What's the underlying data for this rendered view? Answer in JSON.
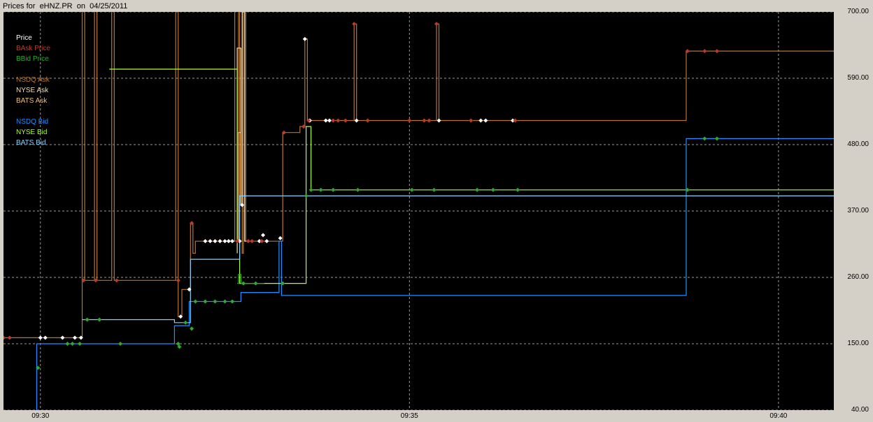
{
  "window": {
    "title": "Prices for  eHNZ.PR  on  04/25/2011"
  },
  "chart_data": {
    "type": "line",
    "title": "Prices for  eHNZ.PR  on  04/25/2011",
    "background": "#000000",
    "grid": true,
    "ylim": [
      40,
      700
    ],
    "yticks": [
      "700.00",
      "590.00",
      "480.00",
      "370.00",
      "260.00",
      "150.00",
      "40.00"
    ],
    "xlim": [
      "09:29:30",
      "09:40:45"
    ],
    "xticks": [
      "09:30",
      "09:35",
      "09:40"
    ],
    "legend_placement": "top-left",
    "legend": [
      {
        "label": "Price",
        "color": "#ffffff"
      },
      {
        "label": "BAsk Price",
        "color": "#c0392b"
      },
      {
        "label": "BBid Price",
        "color": "#2eaa2e"
      },
      {
        "label": "",
        "color": ""
      },
      {
        "label": "NSDQ Ask",
        "color": "#b87333"
      },
      {
        "label": "NYSE Ask",
        "color": "#f5deb3"
      },
      {
        "label": "BATS Ask",
        "color": "#f0c080"
      },
      {
        "label": "",
        "color": ""
      },
      {
        "label": "NSDQ Bid",
        "color": "#1e90ff"
      },
      {
        "label": "NYSE Bid",
        "color": "#adff2f"
      },
      {
        "label": "BATS Bid",
        "color": "#87cefa"
      }
    ],
    "series": [
      {
        "name": "NSDQ Ask",
        "color": "#b87333",
        "points": [
          [
            "09:29:30",
            160
          ],
          [
            "09:30:30",
            160
          ],
          [
            "09:30:34",
            160
          ],
          [
            "09:30:34",
            730
          ],
          [
            "09:30:36",
            730
          ],
          [
            "09:30:36",
            255
          ],
          [
            "09:30:44",
            255
          ],
          [
            "09:30:44",
            730
          ],
          [
            "09:30:46",
            730
          ],
          [
            "09:30:46",
            255
          ],
          [
            "09:30:58",
            255
          ],
          [
            "09:30:58",
            730
          ],
          [
            "09:31:00",
            730
          ],
          [
            "09:31:00",
            255
          ],
          [
            "09:31:50",
            255
          ],
          [
            "09:31:50",
            730
          ],
          [
            "09:31:52",
            730
          ],
          [
            "09:31:52",
            195
          ],
          [
            "09:31:55",
            195
          ],
          [
            "09:31:55",
            240
          ],
          [
            "09:32:02",
            240
          ],
          [
            "09:32:02",
            350
          ],
          [
            "09:32:04",
            350
          ],
          [
            "09:32:04",
            300
          ],
          [
            "09:32:06",
            300
          ],
          [
            "09:32:06",
            320
          ],
          [
            "09:32:38",
            320
          ],
          [
            "09:32:38",
            730
          ],
          [
            "09:32:41",
            730
          ],
          [
            "09:32:41",
            320
          ],
          [
            "09:32:42",
            320
          ],
          [
            "09:32:42",
            700
          ],
          [
            "09:32:44",
            700
          ],
          [
            "09:32:44",
            300
          ],
          [
            "09:32:45",
            300
          ],
          [
            "09:32:45",
            730
          ],
          [
            "09:32:47",
            730
          ],
          [
            "09:32:47",
            320
          ],
          [
            "09:33:17",
            320
          ],
          [
            "09:33:17",
            500
          ],
          [
            "09:33:31",
            500
          ],
          [
            "09:33:31",
            510
          ],
          [
            "09:33:35",
            510
          ],
          [
            "09:33:35",
            655
          ],
          [
            "09:33:37",
            655
          ],
          [
            "09:33:37",
            520
          ],
          [
            "09:34:15",
            520
          ],
          [
            "09:34:15",
            680
          ],
          [
            "09:34:17",
            680
          ],
          [
            "09:34:17",
            520
          ],
          [
            "09:35:22",
            520
          ],
          [
            "09:35:22",
            680
          ],
          [
            "09:35:24",
            680
          ],
          [
            "09:35:24",
            520
          ],
          [
            "09:38:45",
            520
          ],
          [
            "09:38:45",
            635
          ],
          [
            "09:40:45",
            635
          ]
        ]
      },
      {
        "name": "NYSE Ask",
        "color": "#f5deb3",
        "points": [
          [
            "09:32:40",
            300
          ],
          [
            "09:32:40",
            640
          ],
          [
            "09:32:43",
            640
          ],
          [
            "09:32:43",
            380
          ],
          [
            "09:32:44",
            380
          ],
          [
            "09:32:44",
            700
          ],
          [
            "09:32:46",
            700
          ],
          [
            "09:32:46",
            320
          ],
          [
            "09:32:48",
            320
          ]
        ]
      },
      {
        "name": "BATS Ask",
        "color": "#f0c080",
        "points": [
          [
            "09:32:41",
            320
          ],
          [
            "09:32:41",
            500
          ],
          [
            "09:32:43",
            500
          ],
          [
            "09:32:43",
            380
          ]
        ]
      },
      {
        "name": "NSDQ Bid",
        "color": "#1e90ff",
        "points": [
          [
            "09:29:57",
            40
          ],
          [
            "09:29:57",
            150
          ],
          [
            "09:31:49",
            150
          ],
          [
            "09:31:49",
            180
          ],
          [
            "09:32:01",
            180
          ],
          [
            "09:32:01",
            220
          ],
          [
            "09:32:43",
            220
          ],
          [
            "09:32:43",
            235
          ],
          [
            "09:33:14",
            235
          ],
          [
            "09:33:14",
            320
          ],
          [
            "09:33:16",
            320
          ],
          [
            "09:33:16",
            230
          ],
          [
            "09:38:45",
            230
          ],
          [
            "09:38:45",
            490
          ],
          [
            "09:40:45",
            490
          ]
        ]
      },
      {
        "name": "NYSE Bid",
        "color": "#adff2f",
        "points": [
          [
            "09:30:56",
            605
          ],
          [
            "09:32:40",
            605
          ],
          [
            "09:32:40",
            320
          ],
          [
            "09:32:42",
            320
          ],
          [
            "09:32:42",
            250
          ],
          [
            "09:33:36",
            250
          ],
          [
            "09:33:36",
            510
          ],
          [
            "09:33:40",
            510
          ],
          [
            "09:33:40",
            405
          ],
          [
            "09:40:45",
            405
          ]
        ]
      },
      {
        "name": "BATS Bid",
        "color": "#87cefa",
        "points": [
          [
            "09:30:34",
            190
          ],
          [
            "09:31:49",
            190
          ],
          [
            "09:31:49",
            185
          ],
          [
            "09:32:02",
            185
          ],
          [
            "09:32:02",
            290
          ],
          [
            "09:32:42",
            290
          ],
          [
            "09:32:42",
            395
          ],
          [
            "09:40:45",
            395
          ]
        ]
      },
      {
        "name": "BBid Price",
        "color": "#2eaa2e",
        "points": [
          [
            "09:32:40",
            250
          ],
          [
            "09:32:41",
            250
          ],
          [
            "09:32:41",
            265
          ],
          [
            "09:32:43",
            265
          ],
          [
            "09:32:43",
            250
          ],
          [
            "09:33:02",
            250
          ]
        ]
      }
    ],
    "markers": [
      {
        "series": "Price",
        "color": "#ffffff",
        "points": [
          [
            "09:30:00",
            160
          ],
          [
            "09:30:04",
            160
          ],
          [
            "09:30:18",
            160
          ],
          [
            "09:30:28",
            160
          ],
          [
            "09:30:33",
            160
          ],
          [
            "09:31:54",
            195
          ],
          [
            "09:32:01",
            240
          ],
          [
            "09:32:14",
            320
          ],
          [
            "09:32:18",
            320
          ],
          [
            "09:32:22",
            320
          ],
          [
            "09:32:26",
            320
          ],
          [
            "09:32:30",
            320
          ],
          [
            "09:32:33",
            320
          ],
          [
            "09:32:36",
            320
          ],
          [
            "09:32:42",
            320
          ],
          [
            "09:32:44",
            380
          ],
          [
            "09:32:58",
            320
          ],
          [
            "09:33:01",
            330
          ],
          [
            "09:33:04",
            320
          ],
          [
            "09:33:15",
            325
          ],
          [
            "09:33:35",
            655
          ],
          [
            "09:33:39",
            520
          ],
          [
            "09:33:52",
            520
          ],
          [
            "09:33:55",
            520
          ],
          [
            "09:34:17",
            520
          ],
          [
            "09:35:24",
            520
          ],
          [
            "09:35:58",
            520
          ],
          [
            "09:36:02",
            520
          ],
          [
            "09:36:24",
            520
          ]
        ]
      },
      {
        "series": "BAsk Price",
        "color": "#c0392b",
        "points": [
          [
            "09:29:30",
            160
          ],
          [
            "09:29:35",
            160
          ],
          [
            "09:30:35",
            255
          ],
          [
            "09:30:45",
            255
          ],
          [
            "09:31:02",
            255
          ],
          [
            "09:31:52",
            255
          ],
          [
            "09:32:03",
            350
          ],
          [
            "09:32:40",
            320
          ],
          [
            "09:32:49",
            320
          ],
          [
            "09:32:52",
            320
          ],
          [
            "09:33:00",
            320
          ],
          [
            "09:33:18",
            500
          ],
          [
            "09:33:34",
            510
          ],
          [
            "09:33:38",
            520
          ],
          [
            "09:33:58",
            520
          ],
          [
            "09:34:02",
            520
          ],
          [
            "09:34:08",
            520
          ],
          [
            "09:34:15",
            680
          ],
          [
            "09:34:26",
            520
          ],
          [
            "09:35:00",
            520
          ],
          [
            "09:35:12",
            520
          ],
          [
            "09:35:16",
            520
          ],
          [
            "09:35:22",
            680
          ],
          [
            "09:35:50",
            520
          ],
          [
            "09:36:26",
            520
          ],
          [
            "09:38:46",
            635
          ],
          [
            "09:39:00",
            635
          ],
          [
            "09:39:10",
            635
          ]
        ]
      },
      {
        "series": "BBid Price",
        "color": "#2eaa2e",
        "points": [
          [
            "09:29:58",
            110
          ],
          [
            "09:30:22",
            150
          ],
          [
            "09:30:26",
            150
          ],
          [
            "09:30:32",
            150
          ],
          [
            "09:30:38",
            190
          ],
          [
            "09:30:48",
            190
          ],
          [
            "09:31:05",
            150
          ],
          [
            "09:31:52",
            150
          ],
          [
            "09:31:53",
            145
          ],
          [
            "09:31:58",
            185
          ],
          [
            "09:32:03",
            175
          ],
          [
            "09:32:06",
            220
          ],
          [
            "09:32:14",
            220
          ],
          [
            "09:32:22",
            220
          ],
          [
            "09:32:30",
            220
          ],
          [
            "09:32:36",
            220
          ],
          [
            "09:32:45",
            250
          ],
          [
            "09:32:55",
            250
          ],
          [
            "09:33:17",
            250
          ],
          [
            "09:33:36",
            395
          ],
          [
            "09:33:40",
            405
          ],
          [
            "09:33:48",
            405
          ],
          [
            "09:33:58",
            405
          ],
          [
            "09:34:18",
            405
          ],
          [
            "09:35:02",
            405
          ],
          [
            "09:35:20",
            405
          ],
          [
            "09:35:55",
            405
          ],
          [
            "09:36:08",
            405
          ],
          [
            "09:36:28",
            405
          ],
          [
            "09:38:46",
            405
          ],
          [
            "09:39:00",
            490
          ],
          [
            "09:39:10",
            490
          ]
        ]
      }
    ]
  }
}
